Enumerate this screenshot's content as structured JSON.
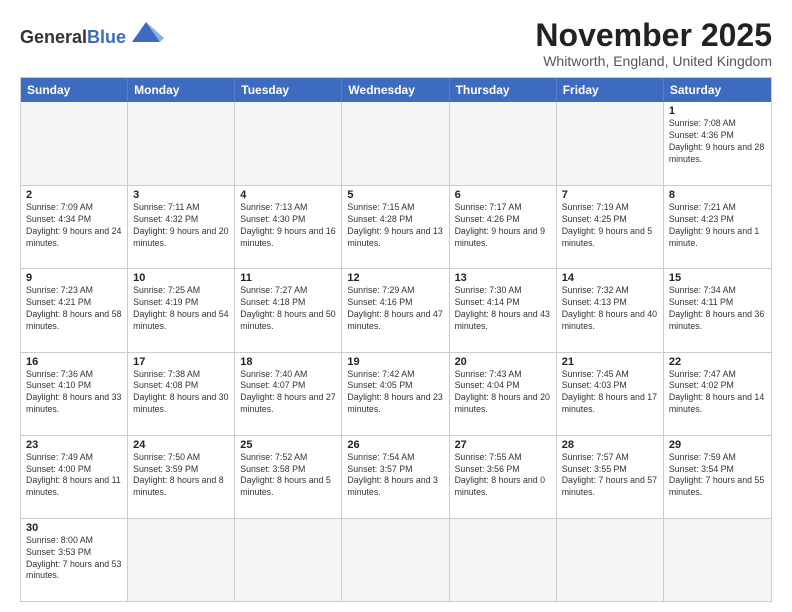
{
  "header": {
    "logo_general": "General",
    "logo_blue": "Blue",
    "month_title": "November 2025",
    "location": "Whitworth, England, United Kingdom"
  },
  "day_headers": [
    "Sunday",
    "Monday",
    "Tuesday",
    "Wednesday",
    "Thursday",
    "Friday",
    "Saturday"
  ],
  "weeks": [
    [
      {
        "date": "",
        "info": "",
        "empty": true
      },
      {
        "date": "",
        "info": "",
        "empty": true
      },
      {
        "date": "",
        "info": "",
        "empty": true
      },
      {
        "date": "",
        "info": "",
        "empty": true
      },
      {
        "date": "",
        "info": "",
        "empty": true
      },
      {
        "date": "",
        "info": "",
        "empty": true
      },
      {
        "date": "1",
        "info": "Sunrise: 7:08 AM\nSunset: 4:36 PM\nDaylight: 9 hours\nand 28 minutes."
      }
    ],
    [
      {
        "date": "2",
        "info": "Sunrise: 7:09 AM\nSunset: 4:34 PM\nDaylight: 9 hours\nand 24 minutes."
      },
      {
        "date": "3",
        "info": "Sunrise: 7:11 AM\nSunset: 4:32 PM\nDaylight: 9 hours\nand 20 minutes."
      },
      {
        "date": "4",
        "info": "Sunrise: 7:13 AM\nSunset: 4:30 PM\nDaylight: 9 hours\nand 16 minutes."
      },
      {
        "date": "5",
        "info": "Sunrise: 7:15 AM\nSunset: 4:28 PM\nDaylight: 9 hours\nand 13 minutes."
      },
      {
        "date": "6",
        "info": "Sunrise: 7:17 AM\nSunset: 4:26 PM\nDaylight: 9 hours\nand 9 minutes."
      },
      {
        "date": "7",
        "info": "Sunrise: 7:19 AM\nSunset: 4:25 PM\nDaylight: 9 hours\nand 5 minutes."
      },
      {
        "date": "8",
        "info": "Sunrise: 7:21 AM\nSunset: 4:23 PM\nDaylight: 9 hours\nand 1 minute."
      }
    ],
    [
      {
        "date": "9",
        "info": "Sunrise: 7:23 AM\nSunset: 4:21 PM\nDaylight: 8 hours\nand 58 minutes."
      },
      {
        "date": "10",
        "info": "Sunrise: 7:25 AM\nSunset: 4:19 PM\nDaylight: 8 hours\nand 54 minutes."
      },
      {
        "date": "11",
        "info": "Sunrise: 7:27 AM\nSunset: 4:18 PM\nDaylight: 8 hours\nand 50 minutes."
      },
      {
        "date": "12",
        "info": "Sunrise: 7:29 AM\nSunset: 4:16 PM\nDaylight: 8 hours\nand 47 minutes."
      },
      {
        "date": "13",
        "info": "Sunrise: 7:30 AM\nSunset: 4:14 PM\nDaylight: 8 hours\nand 43 minutes."
      },
      {
        "date": "14",
        "info": "Sunrise: 7:32 AM\nSunset: 4:13 PM\nDaylight: 8 hours\nand 40 minutes."
      },
      {
        "date": "15",
        "info": "Sunrise: 7:34 AM\nSunset: 4:11 PM\nDaylight: 8 hours\nand 36 minutes."
      }
    ],
    [
      {
        "date": "16",
        "info": "Sunrise: 7:36 AM\nSunset: 4:10 PM\nDaylight: 8 hours\nand 33 minutes."
      },
      {
        "date": "17",
        "info": "Sunrise: 7:38 AM\nSunset: 4:08 PM\nDaylight: 8 hours\nand 30 minutes."
      },
      {
        "date": "18",
        "info": "Sunrise: 7:40 AM\nSunset: 4:07 PM\nDaylight: 8 hours\nand 27 minutes."
      },
      {
        "date": "19",
        "info": "Sunrise: 7:42 AM\nSunset: 4:05 PM\nDaylight: 8 hours\nand 23 minutes."
      },
      {
        "date": "20",
        "info": "Sunrise: 7:43 AM\nSunset: 4:04 PM\nDaylight: 8 hours\nand 20 minutes."
      },
      {
        "date": "21",
        "info": "Sunrise: 7:45 AM\nSunset: 4:03 PM\nDaylight: 8 hours\nand 17 minutes."
      },
      {
        "date": "22",
        "info": "Sunrise: 7:47 AM\nSunset: 4:02 PM\nDaylight: 8 hours\nand 14 minutes."
      }
    ],
    [
      {
        "date": "23",
        "info": "Sunrise: 7:49 AM\nSunset: 4:00 PM\nDaylight: 8 hours\nand 11 minutes."
      },
      {
        "date": "24",
        "info": "Sunrise: 7:50 AM\nSunset: 3:59 PM\nDaylight: 8 hours\nand 8 minutes."
      },
      {
        "date": "25",
        "info": "Sunrise: 7:52 AM\nSunset: 3:58 PM\nDaylight: 8 hours\nand 5 minutes."
      },
      {
        "date": "26",
        "info": "Sunrise: 7:54 AM\nSunset: 3:57 PM\nDaylight: 8 hours\nand 3 minutes."
      },
      {
        "date": "27",
        "info": "Sunrise: 7:55 AM\nSunset: 3:56 PM\nDaylight: 8 hours\nand 0 minutes."
      },
      {
        "date": "28",
        "info": "Sunrise: 7:57 AM\nSunset: 3:55 PM\nDaylight: 7 hours\nand 57 minutes."
      },
      {
        "date": "29",
        "info": "Sunrise: 7:59 AM\nSunset: 3:54 PM\nDaylight: 7 hours\nand 55 minutes."
      }
    ],
    [
      {
        "date": "30",
        "info": "Sunrise: 8:00 AM\nSunset: 3:53 PM\nDaylight: 7 hours\nand 53 minutes.",
        "last_row": true
      },
      {
        "date": "",
        "info": "",
        "empty": true,
        "last_row": true
      },
      {
        "date": "",
        "info": "",
        "empty": true,
        "last_row": true
      },
      {
        "date": "",
        "info": "",
        "empty": true,
        "last_row": true
      },
      {
        "date": "",
        "info": "",
        "empty": true,
        "last_row": true
      },
      {
        "date": "",
        "info": "",
        "empty": true,
        "last_row": true
      },
      {
        "date": "",
        "info": "",
        "empty": true,
        "last_row": true
      }
    ]
  ]
}
